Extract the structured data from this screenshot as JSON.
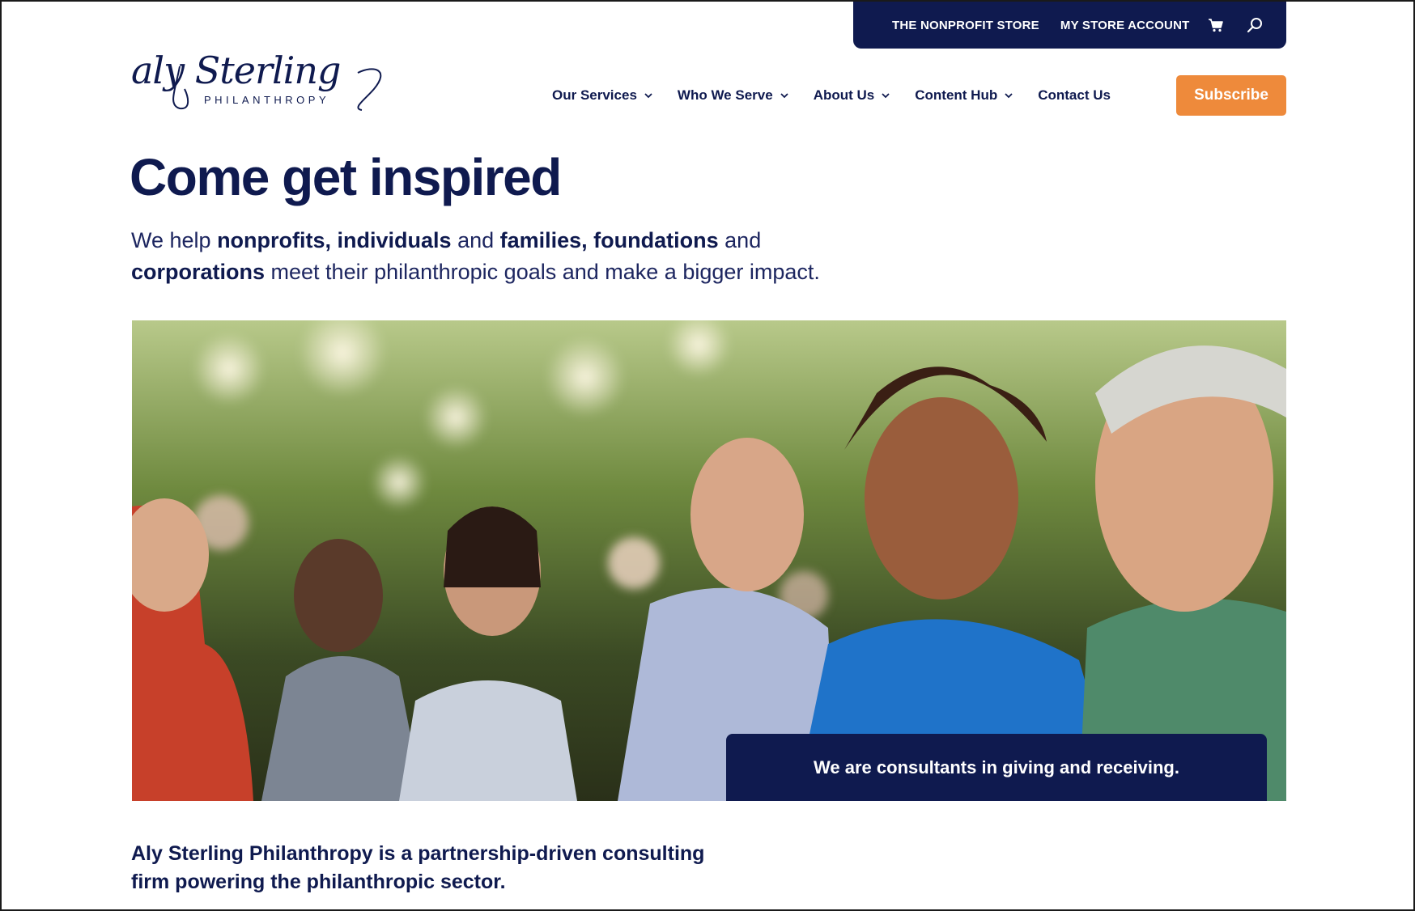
{
  "utility": {
    "store_label": "THE NONPROFIT STORE",
    "account_label": "MY STORE ACCOUNT",
    "cart_icon": "cart-icon",
    "search_icon": "search-icon"
  },
  "logo": {
    "script": "aly Sterling",
    "subtitle": "PHILANTHROPY"
  },
  "nav": {
    "items": [
      {
        "label": "Our Services",
        "has_dropdown": true
      },
      {
        "label": "Who We Serve",
        "has_dropdown": true
      },
      {
        "label": "About Us",
        "has_dropdown": true
      },
      {
        "label": "Content Hub",
        "has_dropdown": true
      },
      {
        "label": "Contact Us",
        "has_dropdown": false
      }
    ],
    "subscribe_label": "Subscribe"
  },
  "hero": {
    "headline": "Come get inspired",
    "lead_parts": [
      {
        "text": "We help ",
        "bold": false
      },
      {
        "text": "nonprofits, individuals",
        "bold": true
      },
      {
        "text": " and ",
        "bold": false
      },
      {
        "text": "families, foundations",
        "bold": true
      },
      {
        "text": " and ",
        "bold": false
      },
      {
        "text": "corporations",
        "bold": true
      },
      {
        "text": " meet their philanthropic goals and make a bigger impact.",
        "bold": false
      }
    ],
    "caption": "We are consultants in giving and receiving."
  },
  "about": {
    "text": "Aly Sterling Philanthropy is a partnership-driven consulting firm powering the philanthropic sector."
  },
  "colors": {
    "navy": "#0f1a4f",
    "accent_orange": "#ee8a3b",
    "white": "#ffffff"
  }
}
